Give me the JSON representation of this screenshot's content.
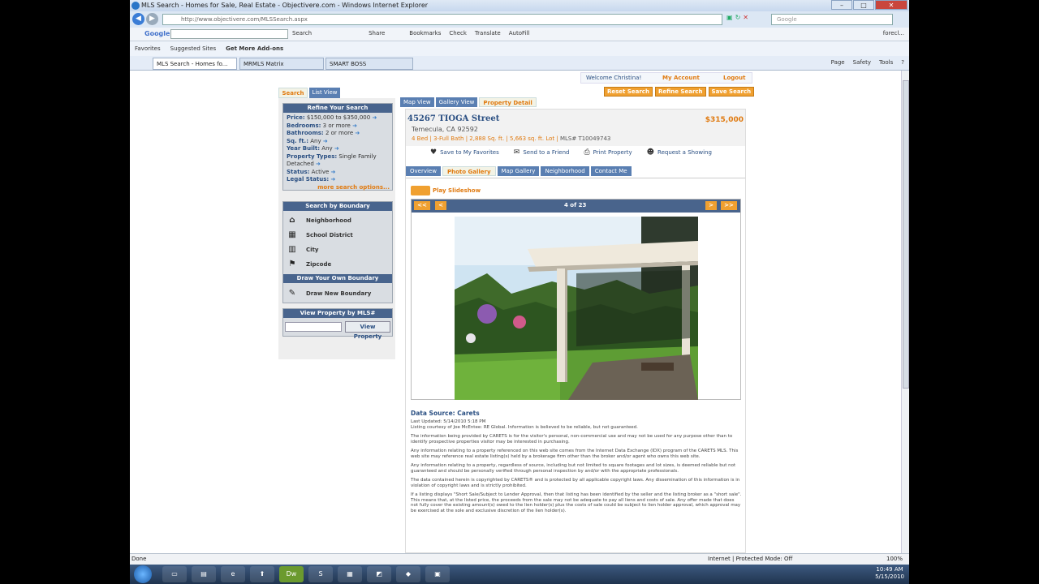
{
  "window": {
    "title": "MLS Search - Homes for Sale, Real Estate - Objectivere.com - Windows Internet Explorer"
  },
  "address": {
    "url": "http://www.objectivere.com/MLSSearch.aspx",
    "search_placeholder": "Google"
  },
  "google_toolbar": {
    "logo": "Google",
    "items": [
      "Search",
      "Share",
      "Bookmarks",
      "Check",
      "Translate",
      "AutoFill"
    ],
    "user": "forecl..."
  },
  "favorites_bar": {
    "favorites": "Favorites",
    "suggested": "Suggested Sites",
    "addons": "Get More Add-ons"
  },
  "tabs": [
    "MLS Search - Homes fo...",
    "MRMLS Matrix",
    "SMART BOSS"
  ],
  "command_bar": {
    "page": "Page",
    "safety": "Safety",
    "tools": "Tools"
  },
  "account": {
    "welcome": "Welcome Christina!",
    "my_account": "My Account",
    "logout": "Logout"
  },
  "search_tabs": {
    "search": "Search",
    "list_view": "List View"
  },
  "action_buttons": {
    "reset": "Reset Search",
    "refine": "Refine Search",
    "save": "Save Search"
  },
  "refine": {
    "header": "Refine Your Search",
    "price_label": "Price:",
    "price": "$150,000 to $350,000",
    "bedrooms_label": "Bedrooms:",
    "bedrooms": "3 or more",
    "bathrooms_label": "Bathrooms:",
    "bathrooms": "2 or more",
    "sqft_label": "Sq. ft.:",
    "sqft": "Any",
    "year_label": "Year Built:",
    "year": "Any",
    "types_label": "Property Types:",
    "types": "Single Family Detached",
    "status_label": "Status:",
    "status": "Active",
    "legal_label": "Legal Status:",
    "more": "more search options..."
  },
  "boundary": {
    "header": "Search by Boundary",
    "items": [
      "Neighborhood",
      "School District",
      "City",
      "Zipcode"
    ],
    "draw_header": "Draw Your Own Boundary",
    "draw_item": "Draw New Boundary"
  },
  "mls_lookup": {
    "header": "View Property by MLS#",
    "button": "View Property"
  },
  "view_tabs": [
    "Map View",
    "Gallery View",
    "Property Detail"
  ],
  "property": {
    "street": "45267 TIOGA Street",
    "price": "$315,000",
    "city": "Temecula, CA 92592",
    "facts": "4 Bed | 3-Full Bath | 2,888 Sq. ft. | 5,663 sq. ft. Lot |",
    "mls": "MLS# T10049743"
  },
  "property_actions": [
    "Save to My Favorites",
    "Send to a Friend",
    "Print Property",
    "Request a Showing"
  ],
  "detail_tabs": [
    "Overview",
    "Photo Gallery",
    "Map Gallery",
    "Neighborhood",
    "Contact Me"
  ],
  "gallery": {
    "slideshow": "Play Slideshow",
    "first": "<<",
    "prev": "<",
    "counter": "4 of 23",
    "next": ">",
    "last": ">>"
  },
  "data_source": {
    "title": "Data Source: Carets",
    "updated": "Last Updated: 5/14/2010 5:18 PM",
    "courtesy": "Listing courtesy of Joe McEntee: RE Global. Information is believed to be reliable, but not guaranteed.",
    "p1": "The information being provided by CARETS is for the visitor's personal, non-commercial use and may not be used for any purpose other than to identify prospective properties visitor may be interested in purchasing.",
    "p2": "Any information relating to a property referenced on this web site comes from the Internet Data Exchange (IDX) program of the CARETS MLS. This web site may reference real estate listing(s) held by a brokerage firm other than the broker and/or agent who owns this web site.",
    "p3": "Any information relating to a property, regardless of source, including but not limited to square footages and lot sizes, is deemed reliable but not guaranteed and should be personally verified through personal inspection by and/or with the appropriate professionals.",
    "p4": "The data contained herein is copyrighted by CARETS® and is protected by all applicable copyright laws. Any dissemination of this information is in violation of copyright laws and is strictly prohibited.",
    "p5": "If a listing displays \"Short Sale/Subject to Lender Approval, then that listing has been identified by the seller and the listing broker as a \"short sale\". This means that, at the listed price, the proceeds from the sale may not be adequate to pay all liens and costs of sale. Any offer made that does not fully cover the existing amount(s) owed to the lien holder(s) plus the costs of sale could be subject to lien holder approval, which approval may be exercised at the sole and exclusive discretion of the lien holder(s)."
  },
  "status": {
    "left": "Done",
    "zone": "Internet | Protected Mode: Off",
    "zoom": "100%"
  },
  "taskbar": {
    "time": "10:49 AM",
    "date": "5/15/2010",
    "dw": "Dw"
  }
}
